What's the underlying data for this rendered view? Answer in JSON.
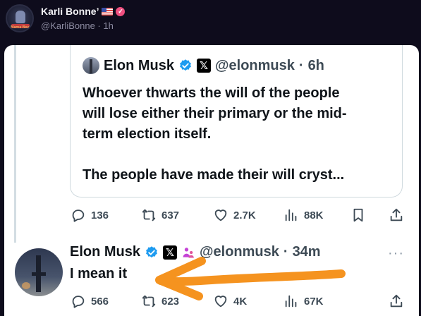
{
  "outer_post": {
    "author_name": "Karli Bonne’",
    "handle": "@KarliBonne",
    "separator": "·",
    "time": "1h",
    "avatar_text": "Mama Bear"
  },
  "quoted_post": {
    "author_name": "Elon Musk",
    "handle": "@elonmusk",
    "separator": "·",
    "time": "6h",
    "x_badge": "𝕏",
    "text": "Whoever thwarts the will of the people\nwill lose either their primary or the mid-\nterm election itself.\n\nThe people have made their will cryst..."
  },
  "quoted_stats": {
    "replies": "136",
    "reposts": "637",
    "likes": "2.7K",
    "views": "88K"
  },
  "reply_post": {
    "author_name": "Elon Musk",
    "handle": "@elonmusk",
    "separator": "·",
    "time": "34m",
    "x_badge": "𝕏",
    "text": "I mean it",
    "more": "···"
  },
  "reply_stats": {
    "replies": "566",
    "reposts": "623",
    "likes": "4K",
    "views": "67K"
  },
  "icons": {
    "verified": "verified-check-icon",
    "x_logo": "x-logo-icon",
    "affiliation": "affiliation-people-icon",
    "reply": "reply-bubble-icon",
    "repost": "repost-icon",
    "like": "heart-icon",
    "views": "views-bars-icon",
    "bookmark": "bookmark-icon",
    "share": "share-icon"
  },
  "colors": {
    "background": "#0e0c1c",
    "card": "#ffffff",
    "verified_blue": "#1d9bf0",
    "annotation_arrow": "#f5931f",
    "badge_pink": "#ef4f7f"
  }
}
